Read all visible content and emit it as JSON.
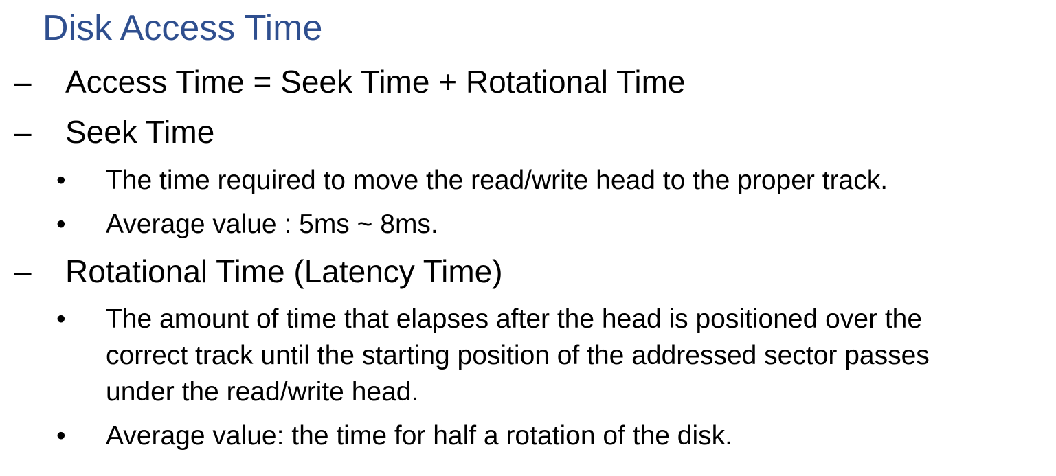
{
  "slide": {
    "title": "Disk Access Time",
    "title_color": "#2f4f8f",
    "items": [
      {
        "marker": "–",
        "text": "Access Time =  Seek Time + Rotational Time"
      },
      {
        "marker": "–",
        "text": "Seek Time"
      },
      {
        "marker": "•",
        "text": "The time required to move the read/write head to the proper track."
      },
      {
        "marker": "•",
        "text": "Average value : 5ms ~ 8ms."
      },
      {
        "marker": "–",
        "text": "Rotational Time (Latency Time)"
      },
      {
        "marker": "•",
        "text": "The amount of time that elapses after the head is positioned over the\ncorrect track until the starting position of the addressed sector passes\nunder the read/write head."
      },
      {
        "marker": "•",
        "text": "Average value: the time for half a rotation of the disk."
      }
    ]
  }
}
